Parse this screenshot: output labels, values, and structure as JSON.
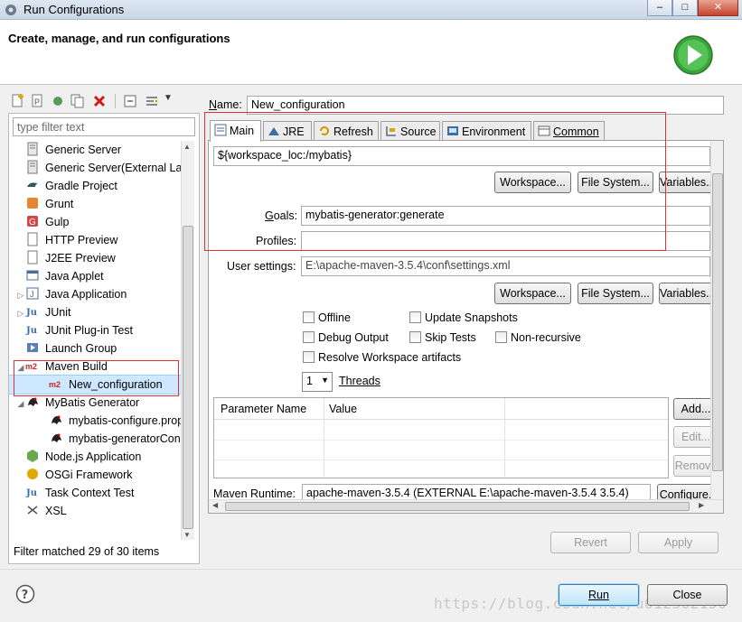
{
  "window": {
    "title": "Run Configurations",
    "controls": [
      "–",
      "□",
      "✕"
    ]
  },
  "header": {
    "title": "Create, manage, and run configurations"
  },
  "left": {
    "filter_placeholder": "type filter text",
    "tree": [
      {
        "label": "Generic Server",
        "icon": "server-icon",
        "indent": 1
      },
      {
        "label": "Generic Server(External La",
        "icon": "server-icon",
        "indent": 1
      },
      {
        "label": "Gradle Project",
        "icon": "gradle-icon",
        "indent": 1
      },
      {
        "label": "Grunt",
        "icon": "grunt-icon",
        "indent": 1
      },
      {
        "label": "Gulp",
        "icon": "gulp-icon",
        "indent": 1
      },
      {
        "label": "HTTP Preview",
        "icon": "page-icon",
        "indent": 1
      },
      {
        "label": "J2EE Preview",
        "icon": "page-icon",
        "indent": 1
      },
      {
        "label": "Java Applet",
        "icon": "applet-icon",
        "indent": 1
      },
      {
        "label": "Java Application",
        "icon": "java-app-icon",
        "indent": 1,
        "twisty": "▷"
      },
      {
        "label": "JUnit",
        "icon": "junit-icon",
        "indent": 1,
        "twisty": "▷"
      },
      {
        "label": "JUnit Plug-in Test",
        "icon": "junit-icon",
        "indent": 1
      },
      {
        "label": "Launch Group",
        "icon": "launch-group-icon",
        "indent": 1
      },
      {
        "label": "Maven Build",
        "icon": "maven-icon",
        "indent": 1,
        "twisty": "◢"
      },
      {
        "label": "New_configuration",
        "icon": "maven-icon",
        "indent": 2,
        "selected": true
      },
      {
        "label": "MyBatis Generator",
        "icon": "mybatis-icon",
        "indent": 1,
        "twisty": "◢"
      },
      {
        "label": "mybatis-configure.prop",
        "icon": "mybatis-icon",
        "indent": 2
      },
      {
        "label": "mybatis-generatorCon",
        "icon": "mybatis-icon",
        "indent": 2
      },
      {
        "label": "Node.js Application",
        "icon": "nodejs-icon",
        "indent": 1
      },
      {
        "label": "OSGi Framework",
        "icon": "osgi-icon",
        "indent": 1
      },
      {
        "label": "Task Context Test",
        "icon": "junit-icon",
        "indent": 1
      },
      {
        "label": "XSL",
        "icon": "xsl-icon",
        "indent": 1
      }
    ],
    "status": "Filter matched 29 of 30 items"
  },
  "right": {
    "name_label": "Name:",
    "name_value": "New_configuration",
    "tabs": [
      {
        "label": "Main",
        "icon": "main-tab-icon",
        "active": true
      },
      {
        "label": "JRE",
        "icon": "jre-icon"
      },
      {
        "label": "Refresh",
        "icon": "refresh-icon"
      },
      {
        "label": "Source",
        "icon": "source-icon"
      },
      {
        "label": "Environment",
        "icon": "environment-icon"
      },
      {
        "label": "Common",
        "icon": "common-icon"
      }
    ],
    "main": {
      "base_directory": "${workspace_loc:/mybatis}",
      "workspace_btn": "Workspace...",
      "filesystem_btn": "File System...",
      "variables_btn": "Variables...",
      "goals_label": "Goals:",
      "goals_value": "mybatis-generator:generate",
      "profiles_label": "Profiles:",
      "profiles_value": "",
      "user_settings_label": "User settings:",
      "user_settings_value": "E:\\apache-maven-3.5.4\\conf\\settings.xml",
      "checkboxes": {
        "offline": "Offline",
        "update_snapshots": "Update Snapshots",
        "debug_output": "Debug Output",
        "skip_tests": "Skip Tests",
        "non_recursive": "Non-recursive",
        "resolve_workspace": "Resolve Workspace artifacts"
      },
      "threads_value": "1",
      "threads_label": "Threads",
      "param_headers": [
        "Parameter Name",
        "Value"
      ],
      "add_btn": "Add...",
      "edit_btn": "Edit...",
      "remove_btn": "Remove",
      "maven_runtime_label": "Maven Runtime:",
      "maven_runtime_value": "apache-maven-3.5.4 (EXTERNAL E:\\apache-maven-3.5.4 3.5.4)",
      "configure_btn": "Configure..."
    },
    "revert_btn": "Revert",
    "apply_btn": "Apply"
  },
  "footer": {
    "run_btn": "Run",
    "close_btn": "Close",
    "watermark": "https://blog.csdn.net/u012302150"
  },
  "colors": {
    "highlight_box": "#e03030",
    "selection": "#cde8ff",
    "run_green": "#3aa33a"
  }
}
